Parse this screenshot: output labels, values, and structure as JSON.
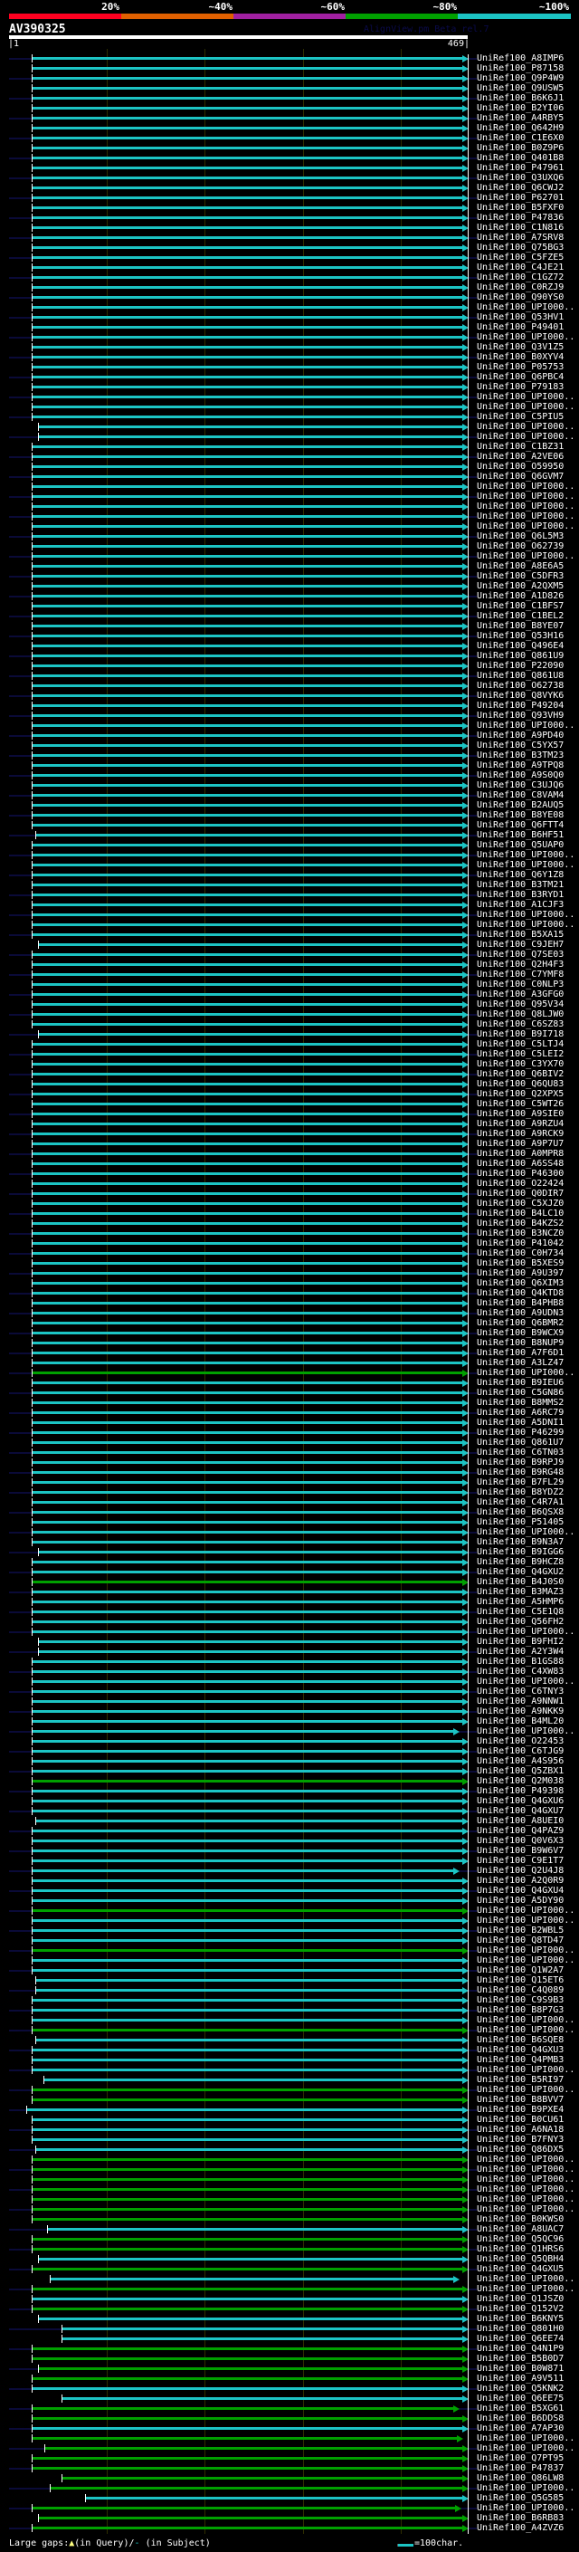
{
  "legend": {
    "ranges": [
      {
        "label": "20%",
        "color": "#ff0020"
      },
      {
        "label": "~40%",
        "color": "#e06000"
      },
      {
        "label": "~60%",
        "color": "#a020a0"
      },
      {
        "label": "~80%",
        "color": "#00a000"
      },
      {
        "label": "~100%",
        "color": "#1cc4c4"
      }
    ]
  },
  "query": {
    "name": "AV390325",
    "start_label": "|1",
    "end_label": "469|",
    "length": 469
  },
  "watermark": "AlignView.pm Beta rel.7",
  "footer": {
    "large_gaps": "Large gaps:",
    "query_gap": "(in Query)/",
    "subject_gap": "(in Subject)",
    "scale_label": "=100char."
  },
  "hit_defaults": {
    "start": 23,
    "end": 469,
    "identity": "~100%"
  },
  "hits_green": [
    132,
    153,
    173,
    186,
    190,
    198,
    204,
    205,
    211,
    212,
    213,
    214,
    215,
    216,
    217,
    219,
    220,
    222,
    224,
    226,
    230,
    231,
    232,
    233,
    236,
    237,
    239,
    240,
    241,
    242,
    243,
    244,
    246,
    247,
    248
  ],
  "hit_starts": {
    "37": 30,
    "38": 30,
    "78": 27,
    "89": 30,
    "98": 30,
    "150": 30,
    "159": 30,
    "160": 30,
    "177": 27,
    "193": 27,
    "194": 27,
    "199": 27,
    "203": 35,
    "206": 18,
    "210": 27,
    "218": 39,
    "221": 30,
    "223": 42,
    "227": 30,
    "228": 54,
    "229": 54,
    "232": 30,
    "235": 54,
    "240": 36,
    "243": 54,
    "244": 42,
    "245": 78,
    "247": 30
  },
  "hit_ends": {
    "168": 460,
    "182": 460,
    "223": 460,
    "236": 460,
    "239": 463,
    "246": 462
  },
  "hits": [
    "UniRef100_A8IMP6",
    "UniRef100_P87158",
    "UniRef100_Q9P4W9",
    "UniRef100_Q9USW5",
    "UniRef100_B6K6J1",
    "UniRef100_B2YI06",
    "UniRef100_A4RBY5",
    "UniRef100_Q642H9",
    "UniRef100_C1E6X0",
    "UniRef100_B0Z9P6",
    "UniRef100_Q401B8",
    "UniRef100_P47961",
    "UniRef100_Q3UXQ6",
    "UniRef100_Q6CWJ2",
    "UniRef100_P62701",
    "UniRef100_B5FXF0",
    "UniRef100_P47836",
    "UniRef100_C1N816",
    "UniRef100_A7SRV8",
    "UniRef100_Q75BG3",
    "UniRef100_C5FZE5",
    "UniRef100_C4JE21",
    "UniRef100_C1GZ72",
    "UniRef100_C0RZJ9",
    "UniRef100_Q90YS0",
    "UniRef100_UPI000..",
    "UniRef100_Q53HV1",
    "UniRef100_P49401",
    "UniRef100_UPI000..",
    "UniRef100_Q3V1Z5",
    "UniRef100_B0XYV4",
    "UniRef100_P05753",
    "UniRef100_Q6PBC4",
    "UniRef100_P79183",
    "UniRef100_UPI000..",
    "UniRef100_UPI000..",
    "UniRef100_C5PIU5",
    "UniRef100_UPI000..",
    "UniRef100_UPI000..",
    "UniRef100_C1BZ31",
    "UniRef100_A2VE06",
    "UniRef100_O59950",
    "UniRef100_Q6GVM7",
    "UniRef100_UPI000..",
    "UniRef100_UPI000..",
    "UniRef100_UPI000..",
    "UniRef100_UPI000..",
    "UniRef100_UPI000..",
    "UniRef100_Q6L5M3",
    "UniRef100_O62739",
    "UniRef100_UPI000..",
    "UniRef100_A8E6A5",
    "UniRef100_C5DFR3",
    "UniRef100_A2QXM5",
    "UniRef100_A1D826",
    "UniRef100_C1BFS7",
    "UniRef100_C1BEL2",
    "UniRef100_B8YE07",
    "UniRef100_Q53H16",
    "UniRef100_Q496E4",
    "UniRef100_Q861U9",
    "UniRef100_P22090",
    "UniRef100_Q861U8",
    "UniRef100_O62738",
    "UniRef100_Q8VYK6",
    "UniRef100_P49204",
    "UniRef100_Q93VH9",
    "UniRef100_UPI000..",
    "UniRef100_A9PD40",
    "UniRef100_C5YX57",
    "UniRef100_B3TM23",
    "UniRef100_A9TPQ8",
    "UniRef100_A9S0Q0",
    "UniRef100_C3UJQ6",
    "UniRef100_C8VAM4",
    "UniRef100_B2AUQ5",
    "UniRef100_B8YE08",
    "UniRef100_Q6FTT4",
    "UniRef100_B6HF51",
    "UniRef100_Q5UAP0",
    "UniRef100_UPI000..",
    "UniRef100_UPI000..",
    "UniRef100_Q6Y1Z8",
    "UniRef100_B3TM21",
    "UniRef100_B3RYD1",
    "UniRef100_A1CJF3",
    "UniRef100_UPI000..",
    "UniRef100_UPI000..",
    "UniRef100_B5XA15",
    "UniRef100_C9JEH7",
    "UniRef100_Q7SE03",
    "UniRef100_Q2H4F3",
    "UniRef100_C7YMF8",
    "UniRef100_C0NLP3",
    "UniRef100_A3GFG0",
    "UniRef100_Q95V34",
    "UniRef100_Q8LJW0",
    "UniRef100_C6SZ83",
    "UniRef100_B9I718",
    "UniRef100_C5LTJ4",
    "UniRef100_C5LEI2",
    "UniRef100_C3YX70",
    "UniRef100_Q6BIV2",
    "UniRef100_Q6QU83",
    "UniRef100_Q2XPX5",
    "UniRef100_C5WT26",
    "UniRef100_A9SIE0",
    "UniRef100_A9RZU4",
    "UniRef100_A9RCK9",
    "UniRef100_A9P7U7",
    "UniRef100_A0MPR8",
    "UniRef100_A6SS48",
    "UniRef100_P46300",
    "UniRef100_O22424",
    "UniRef100_Q0DIR7",
    "UniRef100_C5XJZ0",
    "UniRef100_B4LC10",
    "UniRef100_B4KZS2",
    "UniRef100_B3NCZ0",
    "UniRef100_P41042",
    "UniRef100_C0H734",
    "UniRef100_B5XES9",
    "UniRef100_A9U397",
    "UniRef100_Q6XIM3",
    "UniRef100_Q4KTD8",
    "UniRef100_B4PHB8",
    "UniRef100_A9UDN3",
    "UniRef100_Q6BMR2",
    "UniRef100_B9WCX9",
    "UniRef100_B8NUP9",
    "UniRef100_A7F6D1",
    "UniRef100_A3LZ47",
    "UniRef100_UPI000..",
    "UniRef100_B9IEU6",
    "UniRef100_C5GN86",
    "UniRef100_B8MMS2",
    "UniRef100_A6RC79",
    "UniRef100_A5DNI1",
    "UniRef100_P46299",
    "UniRef100_Q861U7",
    "UniRef100_C6TN03",
    "UniRef100_B9RPJ9",
    "UniRef100_B9RG48",
    "UniRef100_B7FL29",
    "UniRef100_B8YDZ2",
    "UniRef100_C4R7A1",
    "UniRef100_B6QSX8",
    "UniRef100_P51405",
    "UniRef100_UPI000..",
    "UniRef100_B9N3A7",
    "UniRef100_B9IGG6",
    "UniRef100_B9HCZ8",
    "UniRef100_Q4GXU2",
    "UniRef100_B4J0S0",
    "UniRef100_B3MAZ3",
    "UniRef100_A5HMP6",
    "UniRef100_C5E1Q8",
    "UniRef100_Q56FH2",
    "UniRef100_UPI000..",
    "UniRef100_B9FHI2",
    "UniRef100_A2Y3W4",
    "UniRef100_B1GS88",
    "UniRef100_C4XW83",
    "UniRef100_UPI000..",
    "UniRef100_C6TNY3",
    "UniRef100_A9NNW1",
    "UniRef100_A9NKK9",
    "UniRef100_B4ML20",
    "UniRef100_UPI000..",
    "UniRef100_O22453",
    "UniRef100_C6TJG9",
    "UniRef100_A4S956",
    "UniRef100_Q5ZBX1",
    "UniRef100_Q2M038",
    "UniRef100_P49398",
    "UniRef100_Q4GXU6",
    "UniRef100_Q4GXU7",
    "UniRef100_A8UEI0",
    "UniRef100_Q4PAZ9",
    "UniRef100_Q0V6X3",
    "UniRef100_B9W6V7",
    "UniRef100_C9E1T7",
    "UniRef100_Q2U4J8",
    "UniRef100_A2Q0R9",
    "UniRef100_Q4GXU4",
    "UniRef100_A5DY90",
    "UniRef100_UPI000..",
    "UniRef100_UPI000..",
    "UniRef100_B2WBL5",
    "UniRef100_Q8TD47",
    "UniRef100_UPI000..",
    "UniRef100_UPI000..",
    "UniRef100_Q1W2A7",
    "UniRef100_Q15ET6",
    "UniRef100_C4Q089",
    "UniRef100_C9S9B3",
    "UniRef100_B8P7G3",
    "UniRef100_UPI000..",
    "UniRef100_UPI000..",
    "UniRef100_B6SQE8",
    "UniRef100_Q4GXU3",
    "UniRef100_Q4PMB3",
    "UniRef100_UPI000..",
    "UniRef100_B5RI97",
    "UniRef100_UPI000..",
    "UniRef100_B8BVV7",
    "UniRef100_B9PXE4",
    "UniRef100_B0CU61",
    "UniRef100_A6NA18",
    "UniRef100_B7FNY3",
    "UniRef100_Q86DX5",
    "UniRef100_UPI000..",
    "UniRef100_UPI000..",
    "UniRef100_UPI000..",
    "UniRef100_UPI000..",
    "UniRef100_UPI000..",
    "UniRef100_UPI000..",
    "UniRef100_B0KWS0",
    "UniRef100_A8UAC7",
    "UniRef100_Q5QC96",
    "UniRef100_Q1HRS6",
    "UniRef100_Q5QBH4",
    "UniRef100_Q4GXU5",
    "UniRef100_UPI000..",
    "UniRef100_UPI000..",
    "UniRef100_Q1JSZ0",
    "UniRef100_Q152V2",
    "UniRef100_B6KNY5",
    "UniRef100_Q801H0",
    "UniRef100_Q6EE74",
    "UniRef100_Q4N1P9",
    "UniRef100_B5B0D7",
    "UniRef100_B0W871",
    "UniRef100_A9V511",
    "UniRef100_Q5KNK2",
    "UniRef100_Q6EE75",
    "UniRef100_B5XG61",
    "UniRef100_B6DDS8",
    "UniRef100_A7AP30",
    "UniRef100_UPI000..",
    "UniRef100_UPI000..",
    "UniRef100_Q7PT95",
    "UniRef100_P47837",
    "UniRef100_Q86LW8",
    "UniRef100_UPI000..",
    "UniRef100_Q5G585",
    "UniRef100_UPI000..",
    "UniRef100_B6RB83",
    "UniRef100_A4ZVZ6"
  ]
}
